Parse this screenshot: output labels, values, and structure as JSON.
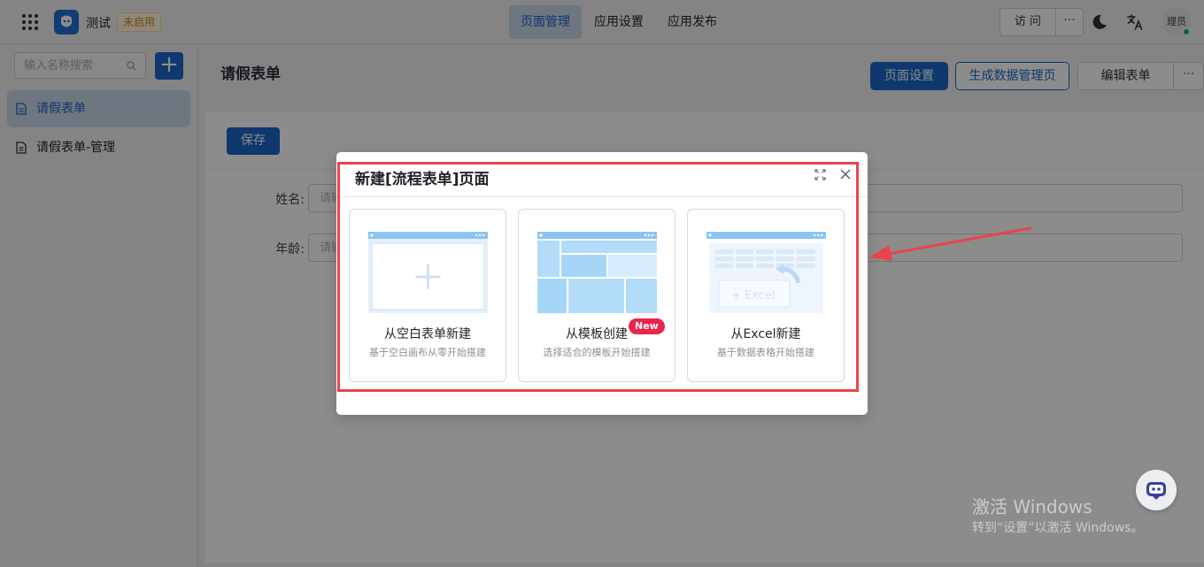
{
  "topbar": {
    "app_name": "测试",
    "app_status": "未启用",
    "nav_tabs": [
      {
        "label": "页面管理",
        "active": true
      },
      {
        "label": "应用设置",
        "active": false
      },
      {
        "label": "应用发布",
        "active": false
      }
    ],
    "visit_label": "访 问",
    "more_label": "···",
    "avatar_text": "理员",
    "icons": [
      "grid-icon",
      "app-logo-icon",
      "moon-icon",
      "translate-icon"
    ]
  },
  "sidebar": {
    "search_placeholder": "输入名称搜索",
    "add_label": "+",
    "items": [
      {
        "label": "请假表单",
        "active": true,
        "icon": "document-icon"
      },
      {
        "label": "请假表单-管理",
        "active": false,
        "icon": "document-icon"
      }
    ]
  },
  "page": {
    "title": "请假表单",
    "page_settings_label": "页面设置",
    "generate_label": "生成数据管理页",
    "edit_form_label": "编辑表单",
    "more_label": "···"
  },
  "canvas": {
    "save_label": "保存",
    "fields": [
      {
        "label": "姓名:",
        "placeholder": "请输"
      },
      {
        "label": "年龄:",
        "placeholder": "请输"
      }
    ]
  },
  "modal": {
    "title": "新建[流程表单]页面",
    "cards": [
      {
        "title": "从空白表单新建",
        "desc": "基于空白画布从零开始搭建"
      },
      {
        "title": "从模板创建",
        "desc": "选择适合的模板开始搭建",
        "badge": "New"
      },
      {
        "title": "从Excel新建",
        "desc": "基于数据表格开始搭建",
        "illustration_text": "+ Excel"
      }
    ]
  },
  "watermark": {
    "title": "激活 Windows",
    "subtitle": "转到“设置”以激活 Windows。"
  },
  "colors": {
    "primary": "#1a66c9",
    "highlight": "#e9434f",
    "badge": "#e8254d",
    "status": "#d48806"
  }
}
